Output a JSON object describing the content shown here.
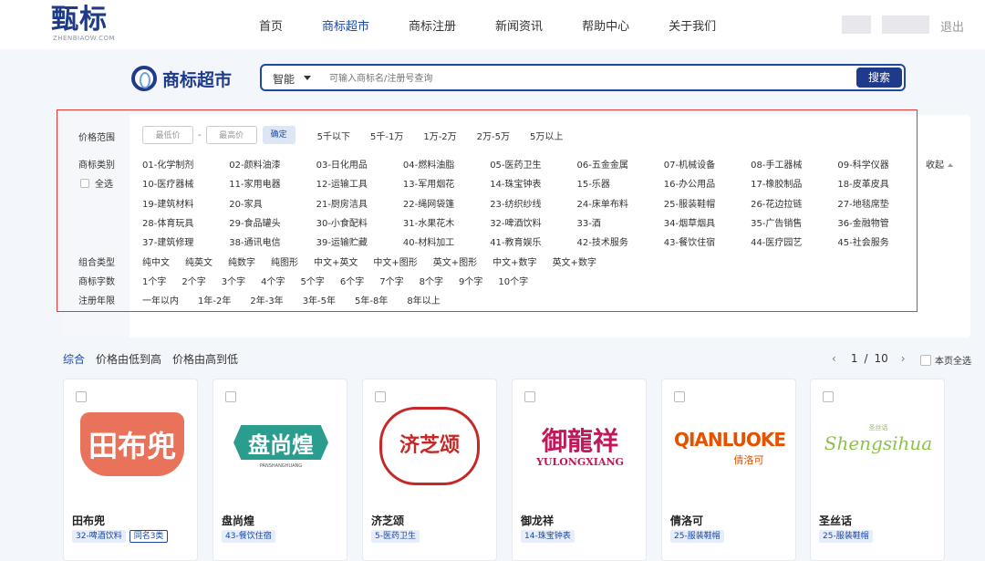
{
  "header": {
    "logo_text": "甄标",
    "logo_sub": "ZHENBIAOW.COM",
    "nav": [
      "首页",
      "商标超市",
      "商标注册",
      "新闻资讯",
      "帮助中心",
      "关于我们"
    ],
    "active_nav": "商标超市",
    "logout": "退出"
  },
  "search": {
    "section_title": "商标超市",
    "mode": "智能",
    "placeholder": "可输入商标名/注册号查询",
    "button": "搜索"
  },
  "filters": {
    "price_label": "价格范围",
    "min_placeholder": "最低价",
    "dash": "-",
    "max_placeholder": "最高价",
    "confirm": "确定",
    "price_ranges": [
      "5千以下",
      "5千-1万",
      "1万-2万",
      "2万-5万",
      "5万以上"
    ],
    "category_label": "商标类别",
    "select_all": "全选",
    "collapse": "收起",
    "categories": [
      "01-化学制剂",
      "02-颜料油漆",
      "03-日化用品",
      "04-燃料油脂",
      "05-医药卫生",
      "06-五金金属",
      "07-机械设备",
      "08-手工器械",
      "09-科学仪器",
      "10-医疗器械",
      "11-家用电器",
      "12-运输工具",
      "13-军用烟花",
      "14-珠宝钟表",
      "15-乐器",
      "16-办公用品",
      "17-橡胶制品",
      "18-皮革皮具",
      "19-建筑材料",
      "20-家具",
      "21-厨房洁具",
      "22-绳网袋篷",
      "23-纺织纱线",
      "24-床单布料",
      "25-服装鞋帽",
      "26-花边拉链",
      "27-地毯席垫",
      "28-体育玩具",
      "29-食品罐头",
      "30-小食配料",
      "31-水果花木",
      "32-啤酒饮料",
      "33-酒",
      "34-烟草烟具",
      "35-广告销售",
      "36-金融物管",
      "37-建筑修理",
      "38-通讯电信",
      "39-运输贮藏",
      "40-材料加工",
      "41-教育娱乐",
      "42-技术服务",
      "43-餐饮住宿",
      "44-医疗园艺",
      "45-社会服务"
    ],
    "combo_label": "组合类型",
    "combo_types": [
      "纯中文",
      "纯英文",
      "纯数字",
      "纯图形",
      "中文+英文",
      "中文+图形",
      "英文+图形",
      "中文+数字",
      "英文+数字"
    ],
    "chars_label": "商标字数",
    "char_counts": [
      "1个字",
      "2个字",
      "3个字",
      "4个字",
      "5个字",
      "6个字",
      "7个字",
      "8个字",
      "9个字",
      "10个字"
    ],
    "years_label": "注册年限",
    "years": [
      "一年以内",
      "1年-2年",
      "2年-3年",
      "3年-5年",
      "5年-8年",
      "8年以上"
    ]
  },
  "sort": {
    "options": [
      "综合",
      "价格由低到高",
      "价格由高到低"
    ],
    "active": "综合",
    "page_current": "1",
    "page_sep": "/",
    "page_total": "10",
    "select_page": "本页全选"
  },
  "cards": [
    {
      "name": "田布兜",
      "tag": "32-啤酒饮料",
      "tag2": "同名3类",
      "logo_text": "田布兜",
      "logo_color": "#e8735a"
    },
    {
      "name": "盘尚煌",
      "tag": "43-餐饮住宿",
      "logo_text": "盘尚煌",
      "logo_sub": "PANSHANGHUANG",
      "logo_color": "#2a9d8f"
    },
    {
      "name": "济芝颂",
      "tag": "5-医药卫生",
      "logo_text": "济芝颂",
      "logo_color": "#c62828"
    },
    {
      "name": "御龙祥",
      "tag": "14-珠宝钟表",
      "logo_text": "御龍祥",
      "logo_sub": "YULONGXIANG",
      "logo_color": "#c2185b"
    },
    {
      "name": "倩洛可",
      "tag": "25-服装鞋帽",
      "logo_text": "QIANLUOKE",
      "logo_sub": "倩洛可",
      "logo_color": "#e65100"
    },
    {
      "name": "圣丝话",
      "tag": "25-服装鞋帽",
      "logo_text": "Shengsihua",
      "logo_sub": "圣丝话",
      "logo_color": "#8bc34a"
    }
  ]
}
